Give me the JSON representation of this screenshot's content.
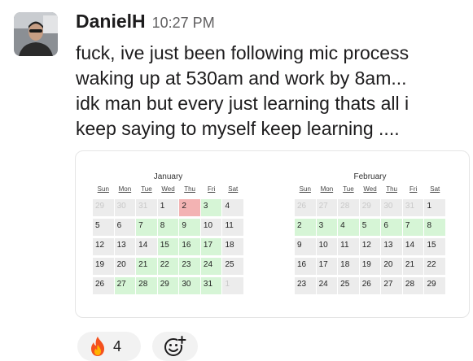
{
  "message": {
    "author": "DanielH",
    "time": "10:27 PM",
    "lines": [
      "fuck, ive just been following mic process",
      "waking up at 530am and work by 8am...",
      "idk man but every just learning thats all i",
      "keep saying to myself keep learning ...."
    ]
  },
  "calendars": [
    {
      "month": "January",
      "dow": [
        "Sun",
        "Mon",
        "Tue",
        "Wed",
        "Thu",
        "Fri",
        "Sat"
      ],
      "weeks": [
        [
          {
            "d": "29",
            "s": "o"
          },
          {
            "d": "30",
            "s": "o"
          },
          {
            "d": "31",
            "s": "o"
          },
          {
            "d": "1",
            "s": ""
          },
          {
            "d": "2",
            "s": "r"
          },
          {
            "d": "3",
            "s": "g"
          },
          {
            "d": "4",
            "s": ""
          }
        ],
        [
          {
            "d": "5",
            "s": ""
          },
          {
            "d": "6",
            "s": ""
          },
          {
            "d": "7",
            "s": "g"
          },
          {
            "d": "8",
            "s": "g"
          },
          {
            "d": "9",
            "s": "g"
          },
          {
            "d": "10",
            "s": ""
          },
          {
            "d": "11",
            "s": ""
          }
        ],
        [
          {
            "d": "12",
            "s": ""
          },
          {
            "d": "13",
            "s": ""
          },
          {
            "d": "14",
            "s": ""
          },
          {
            "d": "15",
            "s": "g"
          },
          {
            "d": "16",
            "s": "g"
          },
          {
            "d": "17",
            "s": "g"
          },
          {
            "d": "18",
            "s": ""
          }
        ],
        [
          {
            "d": "19",
            "s": ""
          },
          {
            "d": "20",
            "s": ""
          },
          {
            "d": "21",
            "s": "g"
          },
          {
            "d": "22",
            "s": "g"
          },
          {
            "d": "23",
            "s": "g"
          },
          {
            "d": "24",
            "s": "g"
          },
          {
            "d": "25",
            "s": ""
          }
        ],
        [
          {
            "d": "26",
            "s": ""
          },
          {
            "d": "27",
            "s": "g"
          },
          {
            "d": "28",
            "s": "g"
          },
          {
            "d": "29",
            "s": "g"
          },
          {
            "d": "30",
            "s": "g"
          },
          {
            "d": "31",
            "s": "g"
          },
          {
            "d": "1",
            "s": "o"
          }
        ]
      ]
    },
    {
      "month": "February",
      "dow": [
        "Sun",
        "Mon",
        "Tue",
        "Wed",
        "Thu",
        "Fri",
        "Sat"
      ],
      "weeks": [
        [
          {
            "d": "26",
            "s": "o"
          },
          {
            "d": "27",
            "s": "o"
          },
          {
            "d": "28",
            "s": "o"
          },
          {
            "d": "29",
            "s": "o"
          },
          {
            "d": "30",
            "s": "o"
          },
          {
            "d": "31",
            "s": "o"
          },
          {
            "d": "1",
            "s": ""
          }
        ],
        [
          {
            "d": "2",
            "s": "g"
          },
          {
            "d": "3",
            "s": "g"
          },
          {
            "d": "4",
            "s": "g"
          },
          {
            "d": "5",
            "s": "g"
          },
          {
            "d": "6",
            "s": "g"
          },
          {
            "d": "7",
            "s": "g"
          },
          {
            "d": "8",
            "s": "g"
          }
        ],
        [
          {
            "d": "9",
            "s": ""
          },
          {
            "d": "10",
            "s": ""
          },
          {
            "d": "11",
            "s": ""
          },
          {
            "d": "12",
            "s": ""
          },
          {
            "d": "13",
            "s": ""
          },
          {
            "d": "14",
            "s": ""
          },
          {
            "d": "15",
            "s": ""
          }
        ],
        [
          {
            "d": "16",
            "s": ""
          },
          {
            "d": "17",
            "s": ""
          },
          {
            "d": "18",
            "s": ""
          },
          {
            "d": "19",
            "s": ""
          },
          {
            "d": "20",
            "s": ""
          },
          {
            "d": "21",
            "s": ""
          },
          {
            "d": "22",
            "s": ""
          }
        ],
        [
          {
            "d": "23",
            "s": ""
          },
          {
            "d": "24",
            "s": ""
          },
          {
            "d": "25",
            "s": ""
          },
          {
            "d": "26",
            "s": ""
          },
          {
            "d": "27",
            "s": ""
          },
          {
            "d": "28",
            "s": ""
          },
          {
            "d": "29",
            "s": ""
          }
        ]
      ]
    }
  ],
  "reactions": [
    {
      "icon": "fire-icon",
      "count": "4"
    },
    {
      "icon": "add-reaction-icon"
    }
  ],
  "colors": {
    "day_done": "#d6f5d6",
    "day_missed": "#f3b3b3",
    "day_default": "#ececec",
    "muted_text": "#616061"
  }
}
